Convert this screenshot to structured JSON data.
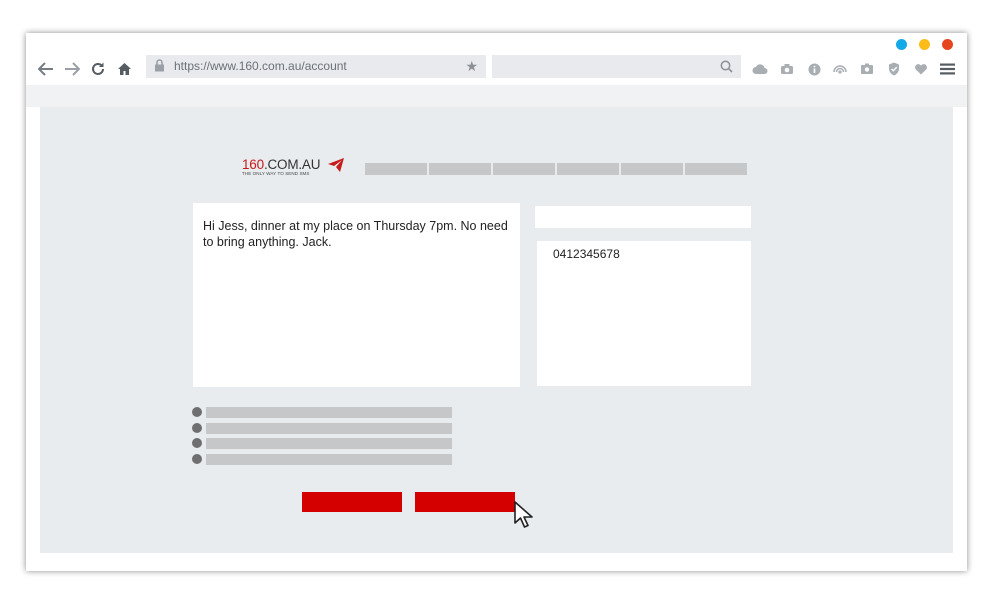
{
  "browser": {
    "window_dots": [
      {
        "name": "blue",
        "color": "#13a9e8"
      },
      {
        "name": "yellow",
        "color": "#fbbc1a"
      },
      {
        "name": "red",
        "color": "#e6461e"
      }
    ],
    "nav_icons": [
      "back-arrow-icon",
      "forward-arrow-icon",
      "reload-icon",
      "home-icon"
    ],
    "address_bar": {
      "url": "https://www.160.com.au/account"
    },
    "search_bar": {
      "value": ""
    },
    "extension_icons": [
      "cloud-icon",
      "camera-icon",
      "info-icon",
      "broadcast-icon",
      "photo-icon",
      "shield-check-icon",
      "heart-icon",
      "menu-icon"
    ]
  },
  "site": {
    "logo": {
      "brand_number": "160",
      "brand_suffix": ".COM.AU",
      "tagline": "THE ONLY WAY TO SEND SMS",
      "accent_color": "#c81a1a"
    },
    "nav_item_count": 6,
    "message": {
      "text": "Hi Jess, dinner at my place on Thursday 7pm. No need to bring anything. Jack."
    },
    "name_field": {
      "value": ""
    },
    "recipients": {
      "value": "0412345678"
    },
    "option_count": 4,
    "buttons": {
      "color": "#d40000"
    }
  }
}
